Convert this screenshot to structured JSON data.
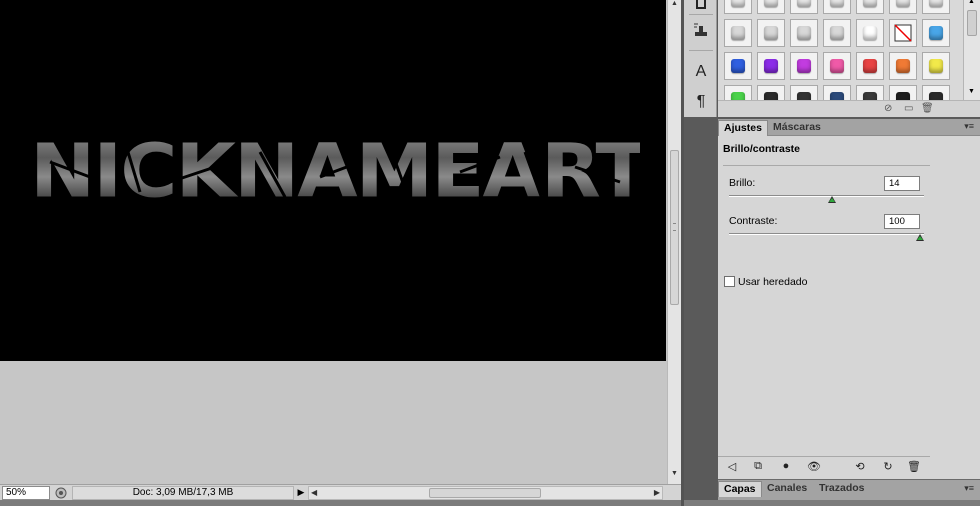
{
  "canvas": {
    "art_text": "NICKNAMEART"
  },
  "status_bar": {
    "zoom": "50%",
    "doc_info": "Doc: 3,09 MB/17,3 MB"
  },
  "tools": {
    "stamp_icon": "stamp-icon",
    "text_tool_label": "A",
    "paragraph_label": "¶"
  },
  "styles_panel": {
    "swatches": [
      [
        "#e8e8e8",
        "#e8e8e8",
        "#e8e8e8",
        "#e8e8e8",
        "#e8e8e8",
        "#e8e8e8",
        "#e8e8e8"
      ],
      [
        "#d8d8d8",
        "#d8d8d8",
        "#d8d8d8",
        "#d8d8d8",
        "#ffffff",
        "none",
        "#49a6e8"
      ],
      [
        "#2f5fe0",
        "#8b2ce8",
        "#c23ce0",
        "#f05aa8",
        "#e84444",
        "#f07a35",
        "#f2e94a"
      ],
      [
        "#4ad24a",
        "#2b2b2b",
        "#333333",
        "#2b4a7a",
        "#3a3a3a",
        "#1e1e1e",
        "#2a2a2a"
      ]
    ]
  },
  "adjustments": {
    "tabs": [
      "Ajustes",
      "Máscaras"
    ],
    "title": "Brillo/contraste",
    "brightness_label": "Brillo:",
    "brightness_value": "14",
    "brightness_fraction": 0.53,
    "contrast_label": "Contraste:",
    "contrast_value": "100",
    "contrast_fraction": 1.0,
    "legacy_label": "Usar heredado"
  },
  "layers_panel": {
    "tabs": [
      "Capas",
      "Canales",
      "Trazados"
    ]
  }
}
